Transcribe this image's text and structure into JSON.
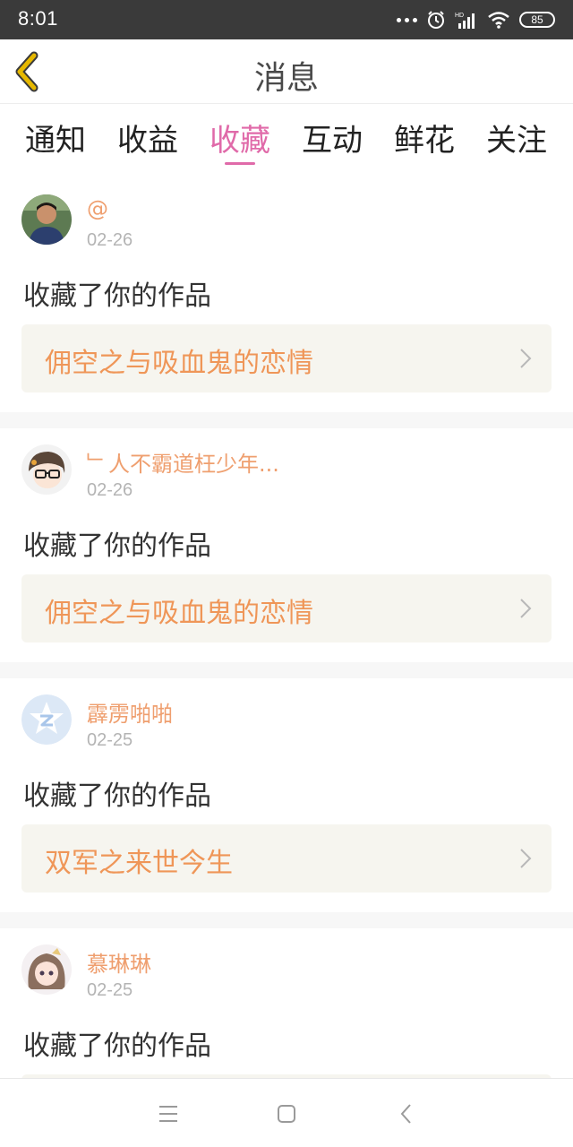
{
  "status_bar": {
    "time": "8:01",
    "battery": "85",
    "icons": [
      "more-dots-icon",
      "alarm-icon",
      "hd-signal-icon",
      "wifi-icon",
      "battery-icon"
    ]
  },
  "header": {
    "title": "消息",
    "back_icon": "chevron-left-icon",
    "accent_color": "#e6b800"
  },
  "tabs": [
    {
      "label": "通知",
      "active": false
    },
    {
      "label": "收益",
      "active": false
    },
    {
      "label": "收藏",
      "active": true
    },
    {
      "label": "互动",
      "active": false
    },
    {
      "label": "鲜花",
      "active": false
    },
    {
      "label": "关注",
      "active": false
    }
  ],
  "colors": {
    "active_tab": "#e06aa9",
    "username": "#ef9f6f",
    "work_title": "#ef9658",
    "card_bg": "#f6f5ef"
  },
  "messages": [
    {
      "username": "@",
      "date": "02-26",
      "action": "收藏了你的作品",
      "work_title": "佣空之与吸血鬼的恋情",
      "avatar": "photo-avatar-boy"
    },
    {
      "username": "﹂人不霸道枉少年...",
      "date": "02-26",
      "action": "收藏了你的作品",
      "work_title": "佣空之与吸血鬼的恋情",
      "avatar": "cartoon-avatar-glasses"
    },
    {
      "username": "霹雳啪啪",
      "date": "02-25",
      "action": "收藏了你的作品",
      "work_title": "双军之来世今生",
      "avatar": "default-avatar-qzone"
    },
    {
      "username": "慕琳琳",
      "date": "02-25",
      "action": "收藏了你的作品",
      "work_title": "",
      "avatar": "anime-avatar-girl"
    }
  ],
  "bottom_nav": {
    "icons": [
      "menu-icon",
      "home-square-icon",
      "back-triangle-icon"
    ]
  }
}
